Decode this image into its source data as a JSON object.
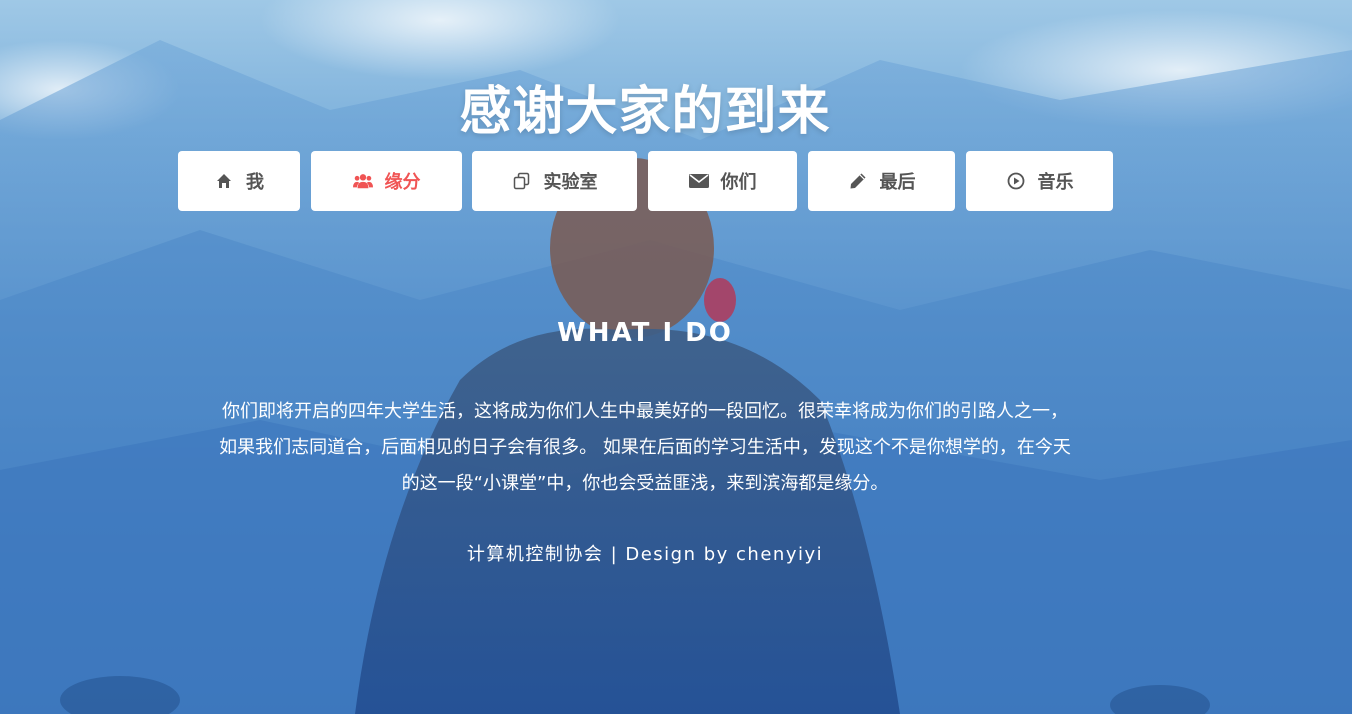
{
  "header": {
    "title": "感谢大家的到来"
  },
  "nav": {
    "items": [
      {
        "label": "我",
        "icon": "home-icon",
        "active": false
      },
      {
        "label": "缘分",
        "icon": "users-icon",
        "active": true
      },
      {
        "label": "实验室",
        "icon": "copy-icon",
        "active": false
      },
      {
        "label": "你们",
        "icon": "envelope-icon",
        "active": false
      },
      {
        "label": "最后",
        "icon": "pencil-icon",
        "active": false
      },
      {
        "label": "音乐",
        "icon": "play-circle-icon",
        "active": false
      }
    ]
  },
  "section": {
    "heading": "WHAT I DO",
    "paragraph": "你们即将开启的四年大学生活，这将成为你们人生中最美好的一段回忆。很荣幸将成为你们的引路人之一，如果我们志同道合，后面相见的日子会有很多。 如果在后面的学习生活中，发现这个不是你想学的，在今天的这一段“小课堂”中，你也会受益匪浅，来到滨海都是缘分。"
  },
  "footer": {
    "text": "计算机控制协会 | Design by chenyiyi"
  },
  "colors": {
    "accent": "#f05454",
    "nav_text": "#555555",
    "nav_bg": "#ffffff"
  }
}
